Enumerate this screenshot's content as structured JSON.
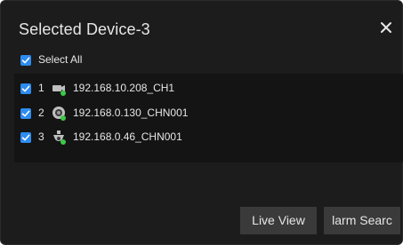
{
  "dialog": {
    "title": "Selected Device-3",
    "close_glyph": "✕"
  },
  "select_all": {
    "label": "Select All",
    "checked": true
  },
  "devices": [
    {
      "index": "1",
      "icon": "camera-online-icon",
      "label": "192.168.10.208_CH1",
      "checked": true
    },
    {
      "index": "2",
      "icon": "dome-camera-icon",
      "label": "192.168.0.130_CHN001",
      "checked": true
    },
    {
      "index": "3",
      "icon": "speed-dome-icon",
      "label": "192.168.0.46_CHN001",
      "checked": true
    }
  ],
  "buttons": {
    "live_view": "Live View",
    "alarm_search": "larm Searc"
  },
  "colors": {
    "panel_bg": "#1c1c1c",
    "list_bg": "#141414",
    "checkbox": "#2d8cf0",
    "button_bg": "#3a3a3a",
    "text": "#e6e6e6",
    "online_dot": "#3cc94a"
  }
}
